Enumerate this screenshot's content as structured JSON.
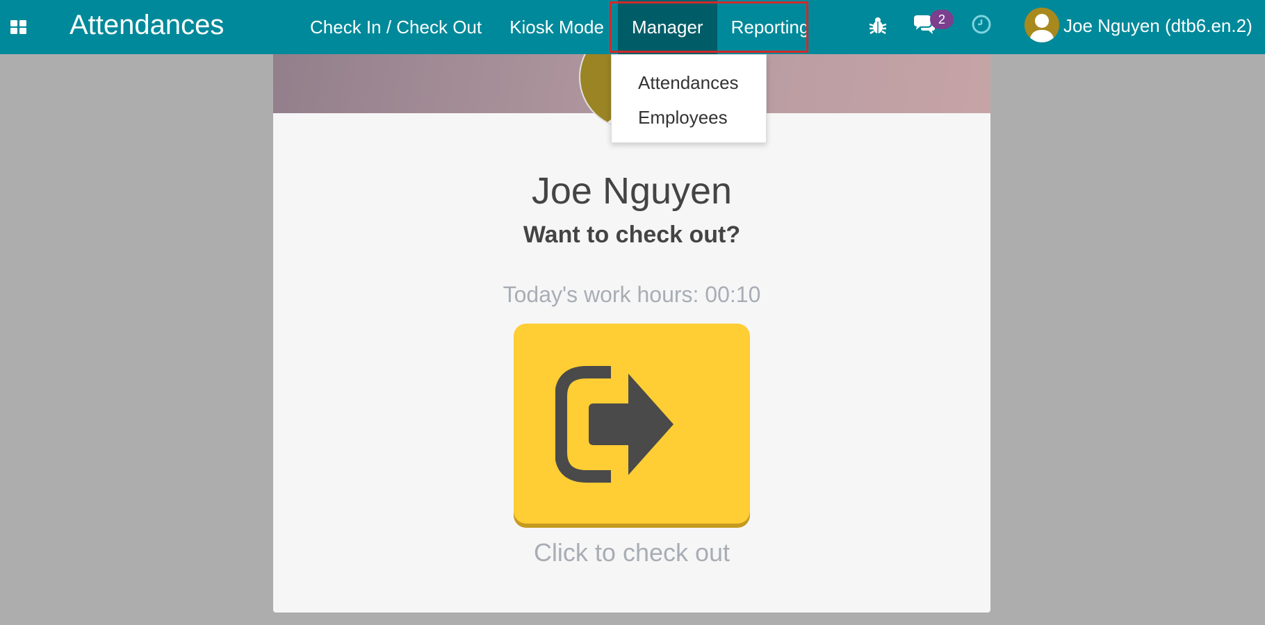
{
  "navbar": {
    "app_title": "Attendances",
    "menu": [
      {
        "label": "Check In / Check Out"
      },
      {
        "label": "Kiosk Mode"
      },
      {
        "label": "Manager"
      },
      {
        "label": "Reporting"
      }
    ],
    "chat_badge_count": "2",
    "user_name": "Joe Nguyen (dtb6.en.2)",
    "icons": [
      "apps-grid-icon",
      "bug-icon",
      "chat-icon",
      "clock-icon",
      "user-avatar"
    ]
  },
  "dropdown": {
    "items": [
      {
        "label": "Attendances"
      },
      {
        "label": "Employees"
      }
    ]
  },
  "card": {
    "employee_name": "Joe Nguyen",
    "question": "Want to check out?",
    "work_hours": "Today's work hours: 00:10",
    "hint": "Click to check out",
    "button_icon": "sign-out-icon"
  },
  "colors": {
    "navbar": "#00899a",
    "navbar_active": "#005d68",
    "highlight": "#d32a2a",
    "badge": "#7b3f8e",
    "button": "#ffcd34",
    "background": "#adadad"
  }
}
